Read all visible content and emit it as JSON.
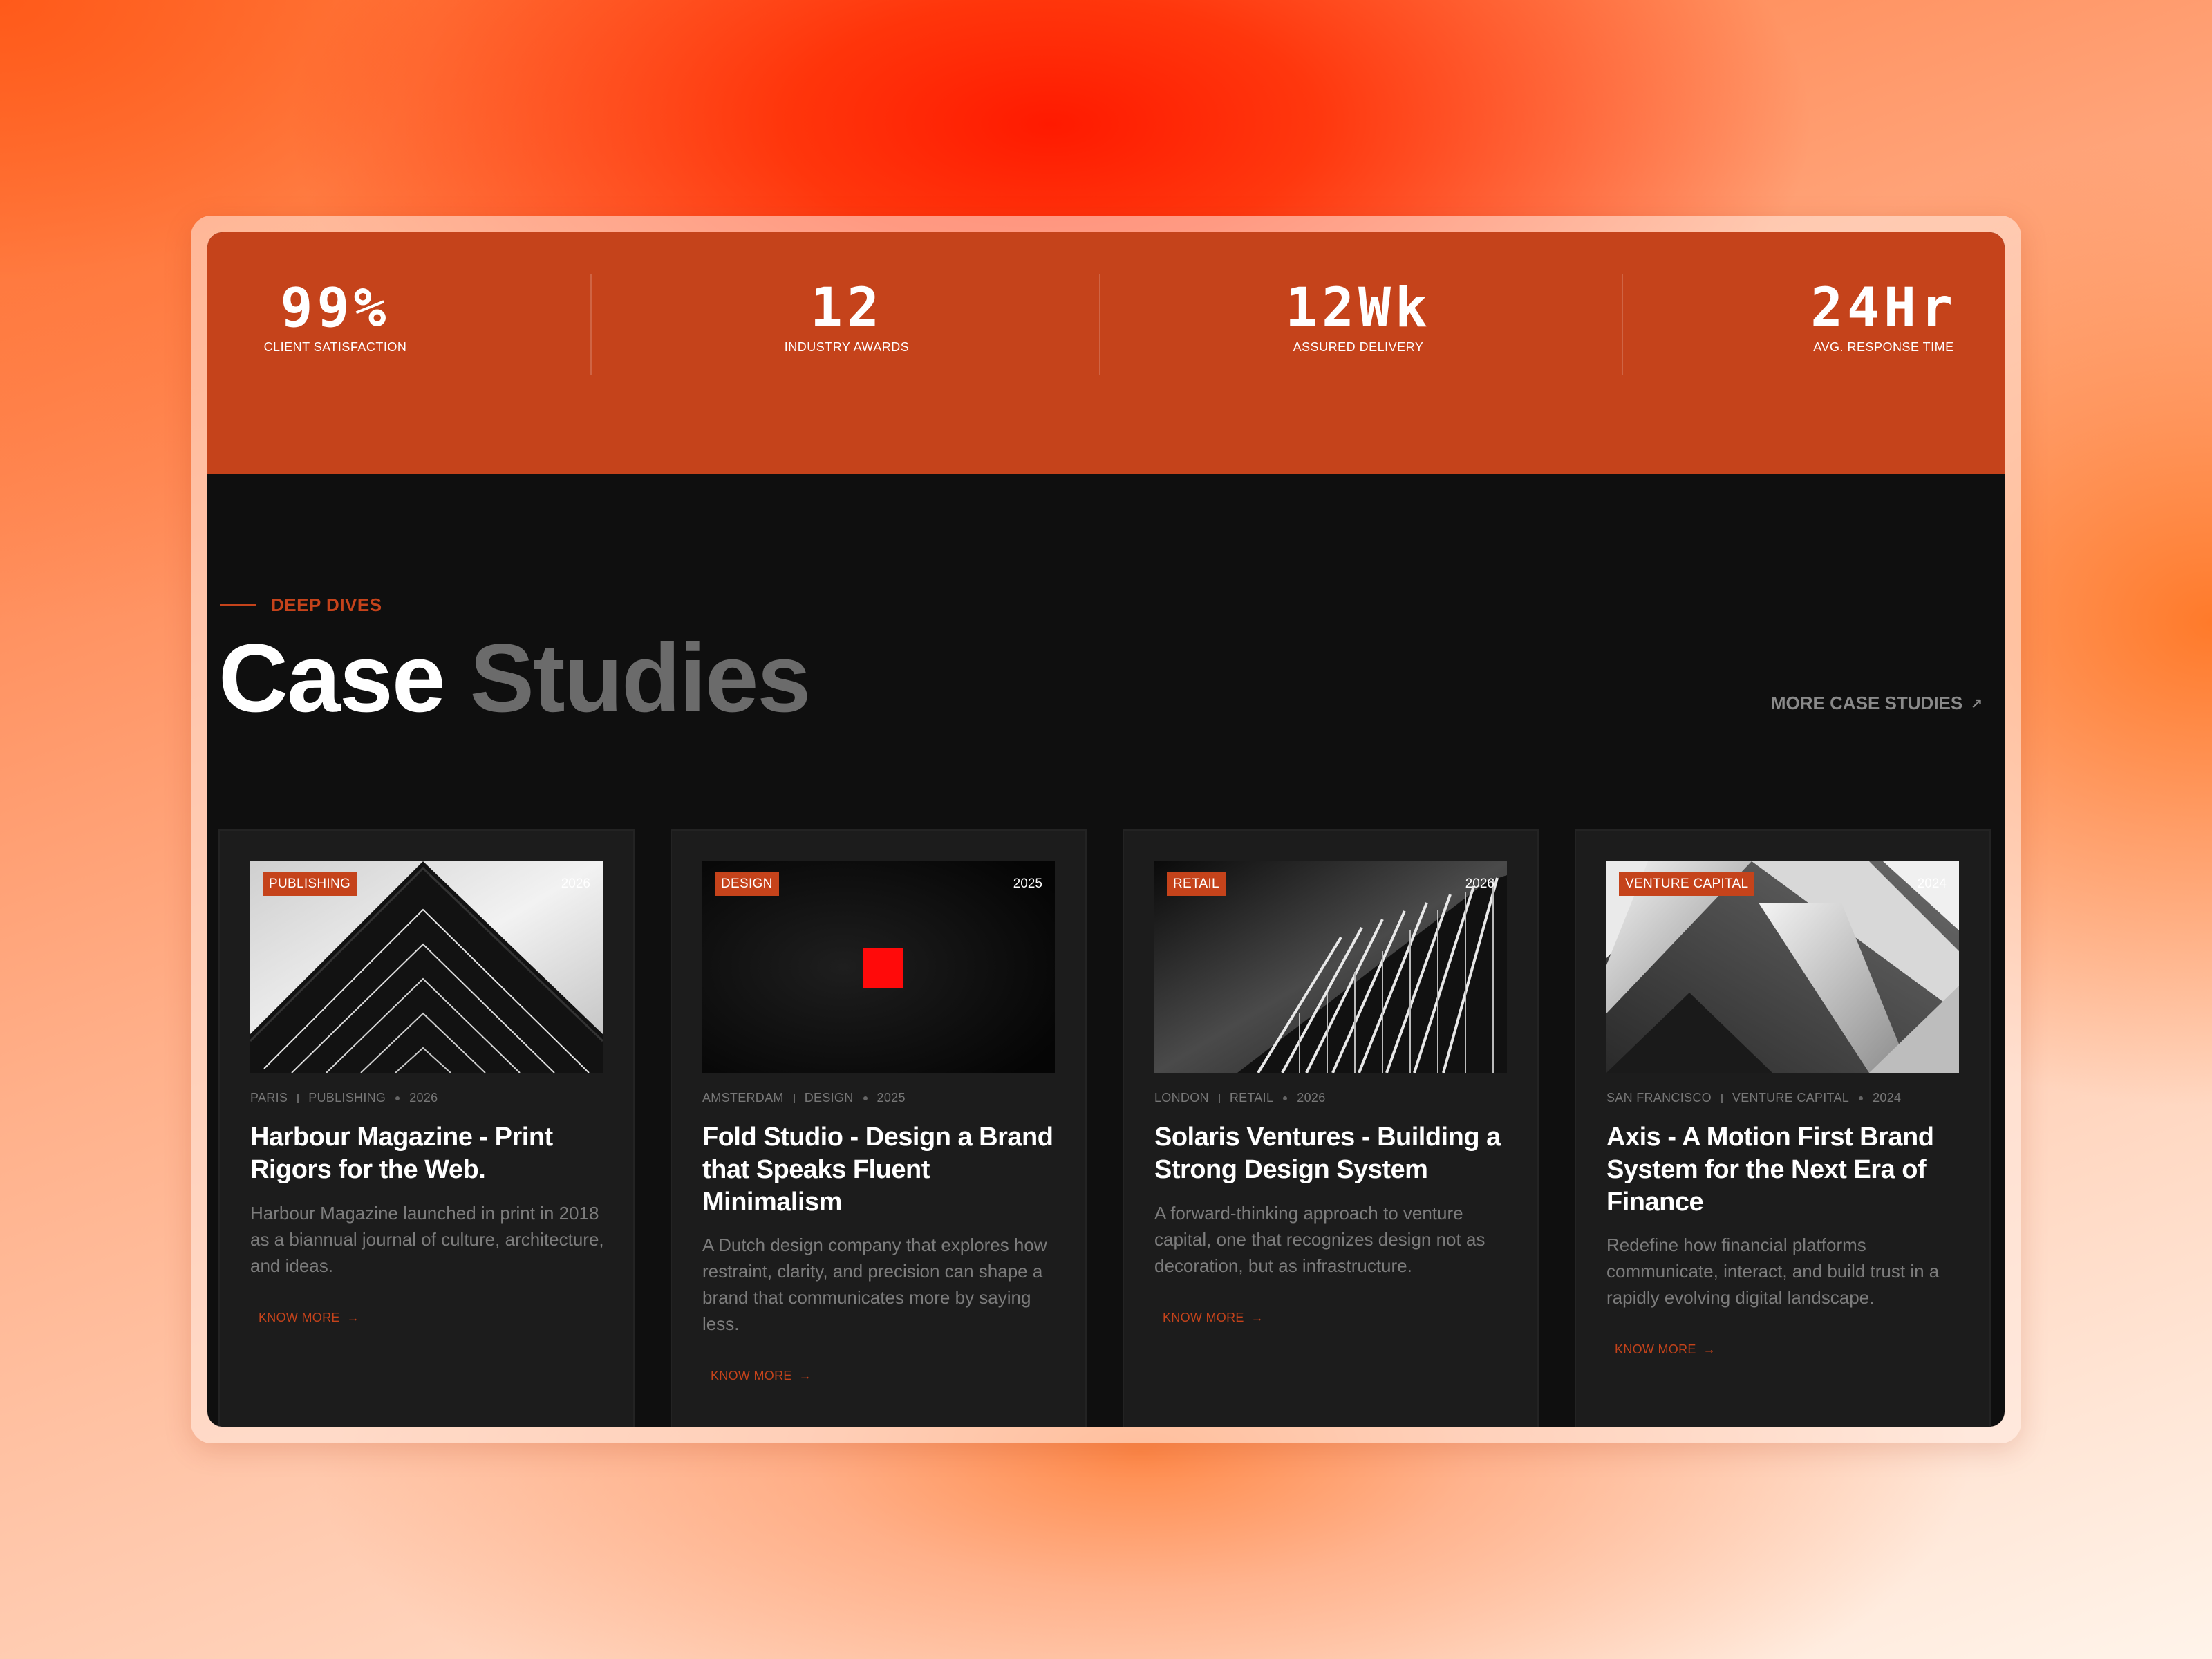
{
  "stats": [
    {
      "value": "99%",
      "label": "CLIENT SATISFACTION"
    },
    {
      "value": "12",
      "label": "INDUSTRY AWARDS"
    },
    {
      "value": "12Wk",
      "label": "ASSURED DELIVERY"
    },
    {
      "value": "24Hr",
      "label": "AVG. RESPONSE TIME"
    }
  ],
  "section": {
    "eyebrow": "DEEP DIVES",
    "title_primary": "Case",
    "title_secondary": "Studies",
    "more_link": "MORE CASE STUDIES",
    "more_arrow": "↗"
  },
  "colors": {
    "accent": "#c5431b",
    "card_bg": "#1c1c1c",
    "page_bg": "#0f0f0f"
  },
  "cards": [
    {
      "tag": "PUBLISHING",
      "year": "2026",
      "location": "PARIS",
      "category": "PUBLISHING",
      "meta_year": "2026",
      "title": "Harbour Magazine - Print Rigors for the Web.",
      "description": "Harbour Magazine launched in print in 2018 as a biannual journal of culture, architecture, and ideas.",
      "cta": "KNOW MORE",
      "cta_arrow": "→",
      "image": "chevron-building-photo"
    },
    {
      "tag": "DESIGN",
      "year": "2025",
      "location": "AMSTERDAM",
      "category": "DESIGN",
      "meta_year": "2025",
      "title": "Fold Studio - Design a Brand that Speaks Fluent Minimalism",
      "description": "A Dutch design company that explores how restraint, clarity, and precision can shape a brand that communicates more by saying less.",
      "cta": "KNOW MORE",
      "cta_arrow": "→",
      "image": "red-square-dark-photo"
    },
    {
      "tag": "RETAIL",
      "year": "2026",
      "location": "LONDON",
      "category": "RETAIL",
      "meta_year": "2026",
      "title": "Solaris Ventures - Building a Strong Design System",
      "description": "A forward-thinking approach to venture capital, one that recognizes design not as decoration, but as infrastructure.",
      "cta": "KNOW MORE",
      "cta_arrow": "→",
      "image": "architecture-fins-photo"
    },
    {
      "tag": "VENTURE CAPITAL",
      "year": "2024",
      "location": "SAN FRANCISCO",
      "category": "VENTURE CAPITAL",
      "meta_year": "2024",
      "title": "Axis - A Motion First Brand System for the Next Era of Finance",
      "description": "Redefine how financial platforms communicate, interact, and build trust in a rapidly evolving digital landscape.",
      "cta": "KNOW MORE",
      "cta_arrow": "→",
      "image": "abstract-chevrons-photo"
    }
  ]
}
